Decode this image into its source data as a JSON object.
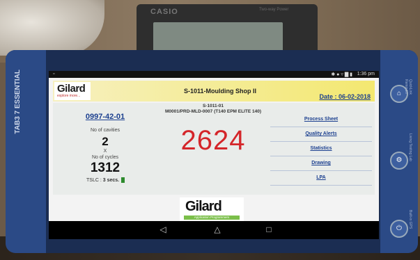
{
  "environment": {
    "calculator_brand": "CASIO",
    "calculator_model": "Two-way Power",
    "tablet_brand": "TAB3 7 ESSENTIAL",
    "side_buttons": [
      {
        "icon": "home-icon",
        "label": "QuickLink Reminder"
      },
      {
        "icon": "settings-icon",
        "label": "Living Testing Lab"
      },
      {
        "icon": "power-icon",
        "label": "Built-in GPS"
      }
    ]
  },
  "status_bar": {
    "left_icon": "notification-icon",
    "icons": "✱ ● ▿ ▇ ▮",
    "time": "1:36 pm"
  },
  "header": {
    "logo_text": "Gilard",
    "logo_tagline": "explore more...",
    "title": "S-1011-Moulding Shop II",
    "date": "Date : 06-02-2018"
  },
  "panel": {
    "machine_id": "S-1011-01",
    "mould_info": "M0001/PRD-MLD-0007 (T140 EPM ELITE 140)",
    "part_number": "0997-42-01",
    "cavities_label": "No of cavities",
    "cavities_value": "2",
    "times_sign": "X",
    "cycles_label": "No of cycles",
    "cycles_value": "1312",
    "tslc_label": "TSLC : ",
    "tslc_value": "3 secs.",
    "count": "2624",
    "links": [
      "Process Sheet",
      "Quality Alerts",
      "Statistics",
      "Drawing",
      "LPA"
    ]
  },
  "footer": {
    "logo_text": "Gilard",
    "logo_sub": "Application Programmers"
  },
  "nav": {
    "back": "◁",
    "home": "△",
    "recents": "□"
  }
}
